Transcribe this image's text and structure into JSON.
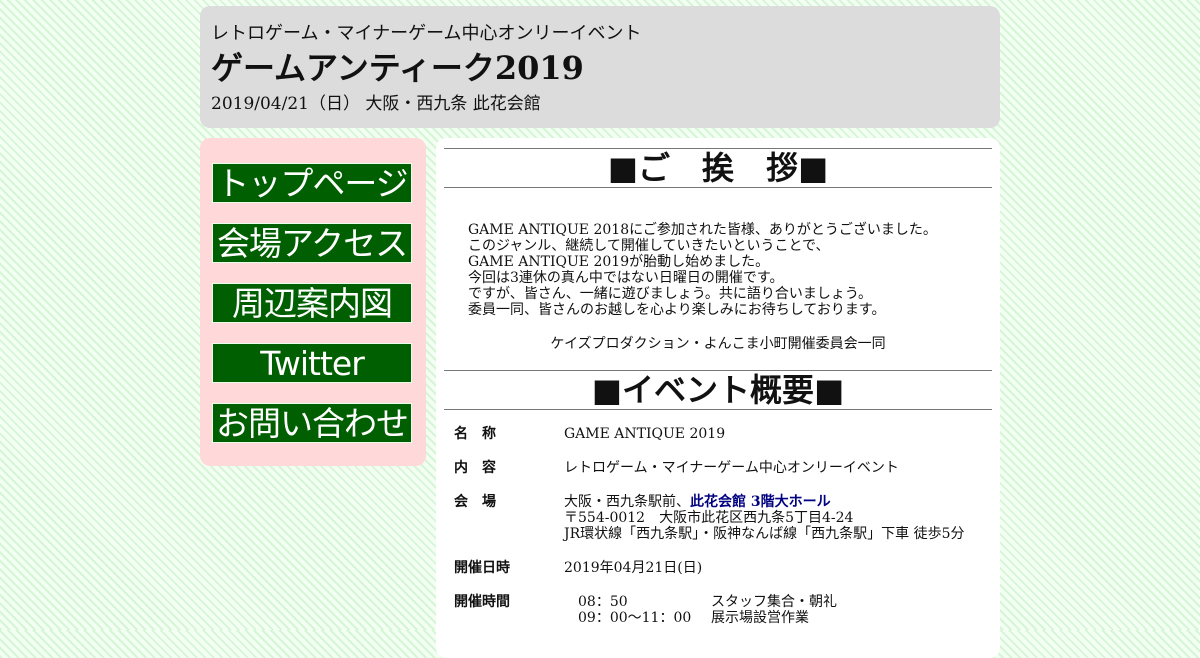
{
  "header": {
    "subtitle": "レトロゲーム・マイナーゲーム中心オンリーイベント",
    "title": "ゲームアンティーク2019",
    "date_place": "2019/04/21（日） 大阪・西九条 此花会館"
  },
  "nav": {
    "items": [
      {
        "label": "トップページ"
      },
      {
        "label": "会場アクセス"
      },
      {
        "label": "周辺案内図"
      },
      {
        "label": "Twitter"
      },
      {
        "label": "お問い合わせ"
      }
    ]
  },
  "greeting": {
    "heading": "■ご　挨　拶■",
    "lines": [
      "GAME ANTIQUE 2018にご参加された皆様、ありがとうございました。",
      "このジャンル、継続して開催していきたいということで、",
      "GAME ANTIQUE 2019が胎動し始めました。",
      "今回は3連休の真ん中ではない日曜日の開催です。",
      "ですが、皆さん、一緒に遊びましょう。共に語り合いましょう。",
      "委員一同、皆さんのお越しを心より楽しみにお待ちしております。"
    ],
    "signature": "ケイズプロダクション・よんこま小町開催委員会一同"
  },
  "overview": {
    "heading": "■イベント概要■",
    "name_label": "名　称",
    "name_value": "GAME ANTIQUE 2019",
    "content_label": "内　容",
    "content_value": "レトロゲーム・マイナーゲーム中心オンリーイベント",
    "venue_label": "会　場",
    "venue_prefix": "大阪・西九条駅前、",
    "venue_link": "此花会館 3階大ホール",
    "venue_address": "〒554-0012　大阪市此花区西九条5丁目4-24",
    "venue_access": "JR環状線「西九条駅」・阪神なんば線「西九条駅」下車 徒歩5分",
    "date_label": "開催日時",
    "date_value": "2019年04月21日(日)",
    "time_label": "開催時間",
    "times": [
      {
        "time": "08：50",
        "desc": "スタッフ集合・朝礼"
      },
      {
        "time": "09：00～11：00",
        "desc": "展示場設営作業"
      }
    ]
  }
}
